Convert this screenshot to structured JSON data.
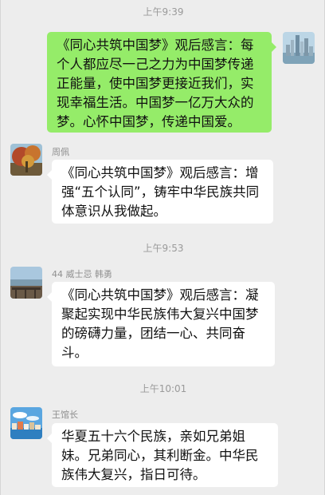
{
  "chat": {
    "timestamps": [
      "上午9:39",
      "上午9:53",
      "上午10:01"
    ],
    "messages": [
      {
        "sender": "",
        "avatar": "city-skyline-avatar",
        "text": "《同心共筑中国梦》观后感言：每个人都应尽一己之力为中国梦传递正能量，使中国梦更接近我们，实现幸福生活。中国梦一亿万大众的梦。心怀中国梦，传递中国爱。"
      },
      {
        "sender": "周佩",
        "avatar": "autumn-tree-avatar",
        "text": "《同心共筑中国梦》观后感言：增强“五个认同”，铸牢中华民族共同体意识从我做起。"
      },
      {
        "sender": "44 威士忌 韩勇",
        "avatar": "lakeside-avatar",
        "text": "《同心共筑中国梦》观后感言：凝聚起实现中华民族伟大复兴中国梦的磅礴力量，团结一心、共同奋斗。"
      },
      {
        "sender": "王馆长",
        "avatar": "seaside-town-avatar",
        "text": "华夏五十六个民族，亲如兄弟姐妹。兄弟同心，其利断金。中华民族伟大复兴，指日可待。"
      }
    ]
  }
}
